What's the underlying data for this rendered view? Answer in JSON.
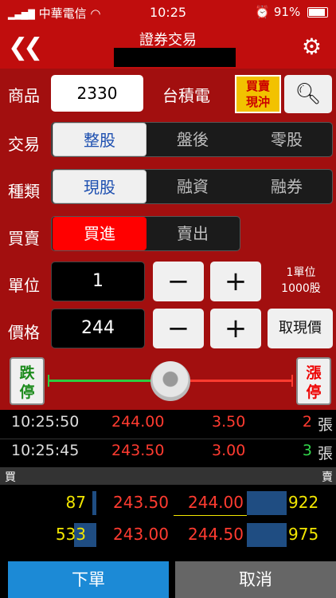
{
  "status": {
    "carrier": "中華電信",
    "time": "10:25",
    "battery": "91%",
    "wifi_icon": "wifi-icon",
    "alarm_icon": "alarm-icon"
  },
  "nav": {
    "title": "證券交易",
    "back_icon": "double-chevron-left-icon",
    "settings_icon": "gear-icon"
  },
  "form": {
    "product_label": "商品",
    "product_code": "2330",
    "product_name": "台積電",
    "buy_sell_switch_line1": "買賣",
    "buy_sell_switch_line2": "現沖",
    "trade_label": "交易",
    "trade_options": [
      "整股",
      "盤後",
      "零股"
    ],
    "trade_selected": "整股",
    "type_label": "種類",
    "type_options": [
      "現股",
      "融資",
      "融券"
    ],
    "type_selected": "現股",
    "side_label": "買賣",
    "side_options": [
      "買進",
      "賣出"
    ],
    "side_selected": "買進",
    "unit_label": "單位",
    "unit_value": "1",
    "unit_note_line1": "1單位",
    "unit_note_line2": "1000股",
    "price_label": "價格",
    "price_value": "244",
    "get_price_label": "取現價",
    "minus": "−",
    "plus": "+"
  },
  "slider": {
    "limit_down_1": "跌",
    "limit_down_2": "停",
    "limit_up_1": "漲",
    "limit_up_2": "停",
    "position": 0.5
  },
  "ticks": [
    {
      "time": "10:25:50",
      "price": "244.00",
      "change": "3.50",
      "volume": "2",
      "volume_color": "#ff3b30",
      "unit": "張"
    },
    {
      "time": "10:25:45",
      "price": "243.50",
      "change": "3.00",
      "volume": "3",
      "volume_color": "#32d74b",
      "unit": "張"
    }
  ],
  "book": {
    "bid_header": "買",
    "ask_header": "賣",
    "rows": [
      {
        "bid_qty": "87",
        "bid_price": "243.50",
        "ask_price": "244.00",
        "ask_qty": "922"
      },
      {
        "bid_qty": "533",
        "bid_price": "243.00",
        "ask_price": "244.50",
        "ask_qty": "975"
      }
    ]
  },
  "actions": {
    "submit": "下單",
    "cancel": "取消"
  },
  "colors": {
    "brand_red": "#c00d0d",
    "panel_red": "#a20f0f",
    "submit_blue": "#1c8ad6",
    "cancel_gray": "#666666"
  }
}
